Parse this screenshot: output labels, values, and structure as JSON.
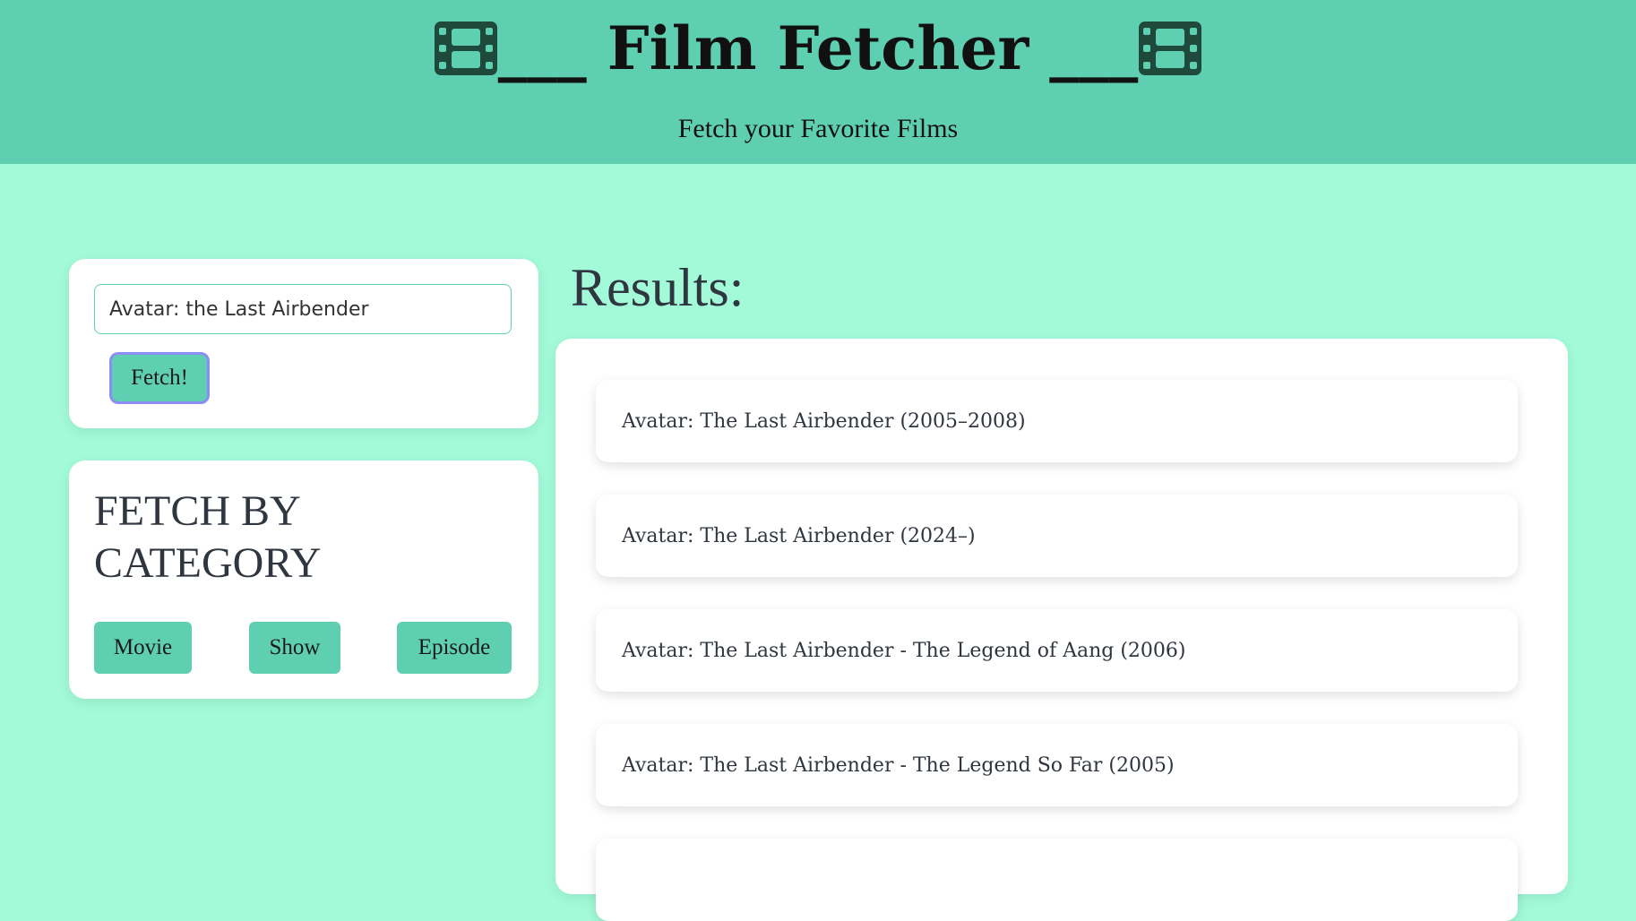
{
  "header": {
    "title": "___ Film Fetcher ___",
    "subtitle": "Fetch your Favorite Films",
    "icon": "film-icon"
  },
  "search": {
    "value": "Avatar: the Last Airbender",
    "button_label": "Fetch!"
  },
  "category": {
    "title": "FETCH BY CATEGORY",
    "buttons": [
      "Movie",
      "Show",
      "Episode"
    ]
  },
  "results": {
    "heading": "Results:",
    "items": [
      "Avatar: The Last Airbender (2005–2008)",
      "Avatar: The Last Airbender (2024–)",
      "Avatar: The Last Airbender - The Legend of Aang (2006)",
      "Avatar: The Last Airbender - The Legend So Far (2005)"
    ]
  },
  "colors": {
    "background": "#a2fad8",
    "header": "#5fcfb2",
    "accent": "#5fcfb2",
    "focus_ring": "#8c8cf5"
  }
}
